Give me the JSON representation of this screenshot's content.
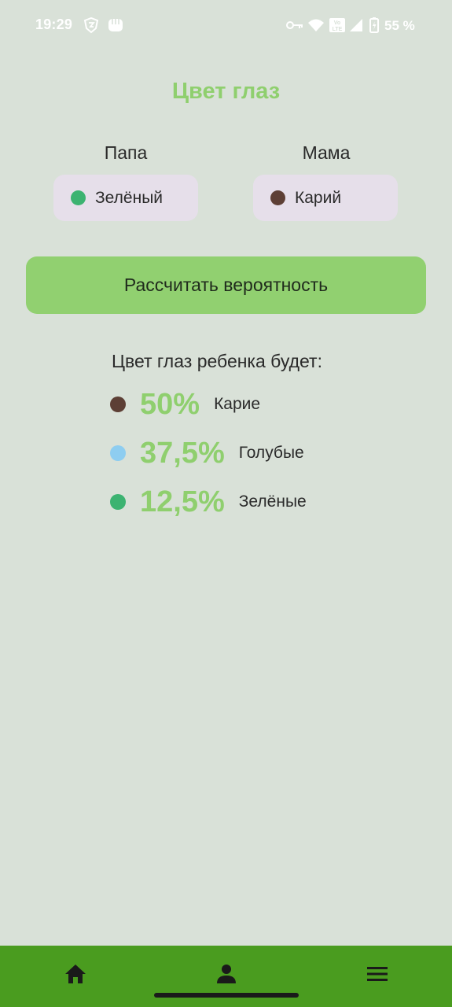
{
  "status_bar": {
    "time": "19:29",
    "battery": "55 %",
    "icons": [
      "vpn-shield-icon",
      "fist-icon",
      "key-icon",
      "wifi-icon",
      "volte-icon",
      "signal-icon",
      "battery-charging-icon"
    ]
  },
  "title": "Цвет глаз",
  "parents": {
    "father": {
      "label": "Папа",
      "value": "Зелёный",
      "color": "#3cb371"
    },
    "mother": {
      "label": "Мама",
      "value": "Карий",
      "color": "#5d3f35"
    }
  },
  "calculate_button": "Рассчитать вероятность",
  "result": {
    "heading": "Цвет глаз ребенка будет:",
    "items": [
      {
        "percent": "50%",
        "label": "Карие",
        "color": "#5d3f35"
      },
      {
        "percent": "37,5%",
        "label": "Голубые",
        "color": "#8ecdf0"
      },
      {
        "percent": "12,5%",
        "label": "Зелёные",
        "color": "#3cb371"
      }
    ]
  },
  "bottom_nav": {
    "background": "#4a9c1f",
    "items": [
      "home-icon",
      "person-icon",
      "menu-icon"
    ]
  },
  "colors": {
    "background": "#d9e1d8",
    "accent": "#8fcf6e",
    "button": "#91d070",
    "select_bg": "#e6dfea"
  }
}
